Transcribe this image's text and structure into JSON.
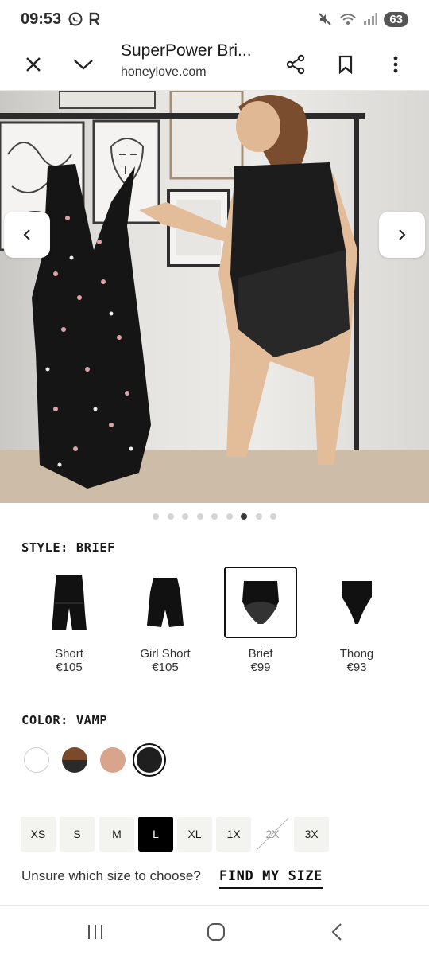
{
  "status_bar": {
    "time": "09:53",
    "battery": "63",
    "left_icons": [
      "whatsapp-icon",
      "r-app-icon"
    ],
    "right_icons": [
      "mute-icon",
      "wifi-icon",
      "signal-icon",
      "battery-icon"
    ]
  },
  "browser": {
    "title": "SuperPower Bri...",
    "url": "honeylove.com",
    "actions": [
      "close-icon",
      "chevron-down-icon",
      "share-icon",
      "bookmark-icon",
      "more-icon"
    ]
  },
  "gallery": {
    "total_slides": 9,
    "active_index": 6
  },
  "style": {
    "label": "STYLE: BRIEF",
    "options": [
      {
        "name": "Short",
        "price": "€105"
      },
      {
        "name": "Girl Short",
        "price": "€105"
      },
      {
        "name": "Brief",
        "price": "€99",
        "selected": true
      },
      {
        "name": "Thong",
        "price": "€93"
      }
    ]
  },
  "color": {
    "label": "COLOR: VAMP",
    "swatches": [
      {
        "name": "white",
        "color": "#ffffff"
      },
      {
        "name": "brown",
        "color": "#7a4a2a"
      },
      {
        "name": "nude",
        "color": "#d9a48c"
      },
      {
        "name": "vamp",
        "color": "#1f1f1f",
        "selected": true
      }
    ]
  },
  "sizes": [
    {
      "label": "XS"
    },
    {
      "label": "S"
    },
    {
      "label": "M"
    },
    {
      "label": "L",
      "selected": true
    },
    {
      "label": "XL"
    },
    {
      "label": "1X"
    },
    {
      "label": "2X",
      "unavailable": true
    },
    {
      "label": "3X"
    }
  ],
  "size_help": {
    "question": "Unsure which size to choose?",
    "link": "FIND MY SIZE"
  }
}
